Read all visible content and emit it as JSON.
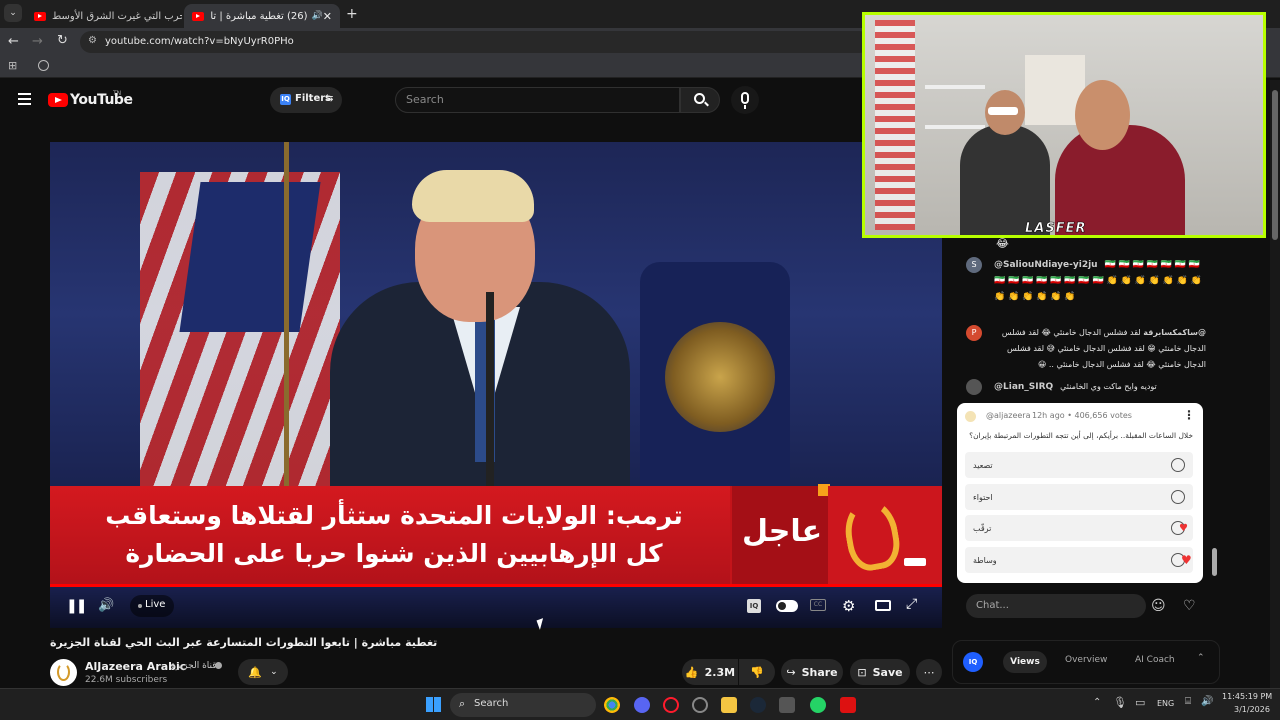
{
  "browser": {
    "tabs": [
      {
        "title": "(26) الحرب التي غيرت الشرق الأوسط"
      },
      {
        "title": "(26) تغطية مباشرة | تابعوا التطورات"
      }
    ],
    "url": "youtube.com/watch?v=bNyUyrR0PHo"
  },
  "youtube": {
    "logo_text": "YouTube",
    "logo_sup": "TN",
    "filters_label": "Filters",
    "search_placeholder": "Search"
  },
  "video": {
    "urgent_label": "عاجل",
    "headline_line1": "ترمب: الولايات المتحدة ستثأر لقتلاها وستعاقب",
    "headline_line2": "كل الإرهابيين الذين شنوا حربا على الحضارة",
    "live_label": "Live",
    "progress": 1.0
  },
  "info": {
    "title": "تغطية مباشرة | تابعوا التطورات المتسارعة عبر البث الحي لقناة الجزيرة",
    "channel_name": "AlJazeera Arabic",
    "channel_name_ar": "قناة الجزيرة",
    "subscribers": "22.6M subscribers",
    "likes": "2.3M",
    "share_label": "Share",
    "save_label": "Save"
  },
  "chat": {
    "messages": [
      {
        "user": "@SaliouNdiaye-yi2ju",
        "text": "🇮🇷 🇮🇷 🇮🇷 🇮🇷 🇮🇷 🇮🇷 🇮🇷 🇮🇷 🇮🇷 🇮🇷 🇮🇷 🇮🇷 🇮🇷 🇮🇷 🇮🇷 👏 👏 👏 👏 👏 👏 👏 👏 👏 👏 👏 👏 👏",
        "avatar": "S",
        "color": "#5f6a7d"
      },
      {
        "user": "@ساكمكسابرقة",
        "text": "لقد فشلس الدجال خامنئي 😂 لقد فشلس الدجال خامنئي 😁 لقد فشلس الدجال خامنئي 😅 لقد فشلس الدجال خامنئي 😂 لقد فشلس الدجال خامنئي .. 😀",
        "avatar": "P",
        "color": "#d44a2f"
      },
      {
        "user": "@Lian_SIRQ",
        "text": "توديه وايح ماكت وي الخامنئي",
        "avatar": "",
        "color": "#555"
      }
    ],
    "poll": {
      "author": "@aljazeera",
      "meta": "12h ago • 406,656 votes",
      "question": "خلال الساعات المقبلة.. برأيكم، إلى أين تتجه التطورات المرتبطة بإيران؟",
      "options": [
        "تصعيد",
        "احتواء",
        "ترقّب",
        "وساطة"
      ]
    },
    "input_placeholder": "Chat..."
  },
  "iq_panel": {
    "tabs": [
      "Views",
      "Overview",
      "AI Coach"
    ],
    "active": "Views"
  },
  "webcam": {
    "overlay_name": "LASFER"
  },
  "taskbar": {
    "search_label": "Search",
    "lang": "ENG",
    "time": "11:45:19 PM",
    "date": "3/1/2026"
  }
}
